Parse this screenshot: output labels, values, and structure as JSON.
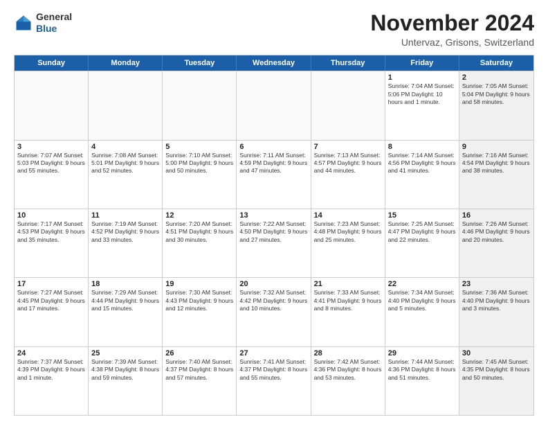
{
  "logo": {
    "general": "General",
    "blue": "Blue"
  },
  "title": "November 2024",
  "location": "Untervaz, Grisons, Switzerland",
  "days_of_week": [
    "Sunday",
    "Monday",
    "Tuesday",
    "Wednesday",
    "Thursday",
    "Friday",
    "Saturday"
  ],
  "weeks": [
    [
      {
        "day": "",
        "info": "",
        "empty": true
      },
      {
        "day": "",
        "info": "",
        "empty": true
      },
      {
        "day": "",
        "info": "",
        "empty": true
      },
      {
        "day": "",
        "info": "",
        "empty": true
      },
      {
        "day": "",
        "info": "",
        "empty": true
      },
      {
        "day": "1",
        "info": "Sunrise: 7:04 AM\nSunset: 5:06 PM\nDaylight: 10 hours\nand 1 minute."
      },
      {
        "day": "2",
        "info": "Sunrise: 7:05 AM\nSunset: 5:04 PM\nDaylight: 9 hours\nand 58 minutes.",
        "shaded": true
      }
    ],
    [
      {
        "day": "3",
        "info": "Sunrise: 7:07 AM\nSunset: 5:03 PM\nDaylight: 9 hours\nand 55 minutes."
      },
      {
        "day": "4",
        "info": "Sunrise: 7:08 AM\nSunset: 5:01 PM\nDaylight: 9 hours\nand 52 minutes."
      },
      {
        "day": "5",
        "info": "Sunrise: 7:10 AM\nSunset: 5:00 PM\nDaylight: 9 hours\nand 50 minutes."
      },
      {
        "day": "6",
        "info": "Sunrise: 7:11 AM\nSunset: 4:59 PM\nDaylight: 9 hours\nand 47 minutes."
      },
      {
        "day": "7",
        "info": "Sunrise: 7:13 AM\nSunset: 4:57 PM\nDaylight: 9 hours\nand 44 minutes."
      },
      {
        "day": "8",
        "info": "Sunrise: 7:14 AM\nSunset: 4:56 PM\nDaylight: 9 hours\nand 41 minutes."
      },
      {
        "day": "9",
        "info": "Sunrise: 7:16 AM\nSunset: 4:54 PM\nDaylight: 9 hours\nand 38 minutes.",
        "shaded": true
      }
    ],
    [
      {
        "day": "10",
        "info": "Sunrise: 7:17 AM\nSunset: 4:53 PM\nDaylight: 9 hours\nand 35 minutes."
      },
      {
        "day": "11",
        "info": "Sunrise: 7:19 AM\nSunset: 4:52 PM\nDaylight: 9 hours\nand 33 minutes."
      },
      {
        "day": "12",
        "info": "Sunrise: 7:20 AM\nSunset: 4:51 PM\nDaylight: 9 hours\nand 30 minutes."
      },
      {
        "day": "13",
        "info": "Sunrise: 7:22 AM\nSunset: 4:50 PM\nDaylight: 9 hours\nand 27 minutes."
      },
      {
        "day": "14",
        "info": "Sunrise: 7:23 AM\nSunset: 4:48 PM\nDaylight: 9 hours\nand 25 minutes."
      },
      {
        "day": "15",
        "info": "Sunrise: 7:25 AM\nSunset: 4:47 PM\nDaylight: 9 hours\nand 22 minutes."
      },
      {
        "day": "16",
        "info": "Sunrise: 7:26 AM\nSunset: 4:46 PM\nDaylight: 9 hours\nand 20 minutes.",
        "shaded": true
      }
    ],
    [
      {
        "day": "17",
        "info": "Sunrise: 7:27 AM\nSunset: 4:45 PM\nDaylight: 9 hours\nand 17 minutes."
      },
      {
        "day": "18",
        "info": "Sunrise: 7:29 AM\nSunset: 4:44 PM\nDaylight: 9 hours\nand 15 minutes."
      },
      {
        "day": "19",
        "info": "Sunrise: 7:30 AM\nSunset: 4:43 PM\nDaylight: 9 hours\nand 12 minutes."
      },
      {
        "day": "20",
        "info": "Sunrise: 7:32 AM\nSunset: 4:42 PM\nDaylight: 9 hours\nand 10 minutes."
      },
      {
        "day": "21",
        "info": "Sunrise: 7:33 AM\nSunset: 4:41 PM\nDaylight: 9 hours\nand 8 minutes."
      },
      {
        "day": "22",
        "info": "Sunrise: 7:34 AM\nSunset: 4:40 PM\nDaylight: 9 hours\nand 5 minutes."
      },
      {
        "day": "23",
        "info": "Sunrise: 7:36 AM\nSunset: 4:40 PM\nDaylight: 9 hours\nand 3 minutes.",
        "shaded": true
      }
    ],
    [
      {
        "day": "24",
        "info": "Sunrise: 7:37 AM\nSunset: 4:39 PM\nDaylight: 9 hours\nand 1 minute."
      },
      {
        "day": "25",
        "info": "Sunrise: 7:39 AM\nSunset: 4:38 PM\nDaylight: 8 hours\nand 59 minutes."
      },
      {
        "day": "26",
        "info": "Sunrise: 7:40 AM\nSunset: 4:37 PM\nDaylight: 8 hours\nand 57 minutes."
      },
      {
        "day": "27",
        "info": "Sunrise: 7:41 AM\nSunset: 4:37 PM\nDaylight: 8 hours\nand 55 minutes."
      },
      {
        "day": "28",
        "info": "Sunrise: 7:42 AM\nSunset: 4:36 PM\nDaylight: 8 hours\nand 53 minutes."
      },
      {
        "day": "29",
        "info": "Sunrise: 7:44 AM\nSunset: 4:36 PM\nDaylight: 8 hours\nand 51 minutes."
      },
      {
        "day": "30",
        "info": "Sunrise: 7:45 AM\nSunset: 4:35 PM\nDaylight: 8 hours\nand 50 minutes.",
        "shaded": true
      }
    ]
  ]
}
